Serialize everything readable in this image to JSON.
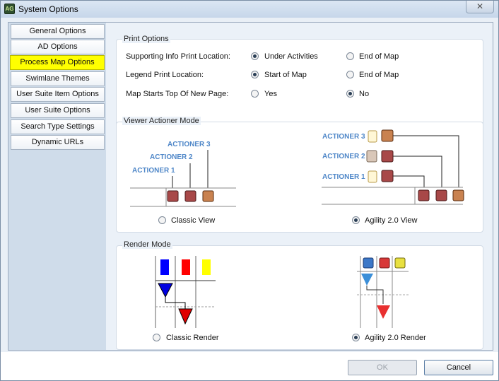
{
  "window": {
    "title": "System Options",
    "close_glyph": "✕",
    "icon_text": "AG"
  },
  "tabs": [
    {
      "label": "General Options"
    },
    {
      "label": "AD Options"
    },
    {
      "label": "Process Map Options"
    },
    {
      "label": "Swimlane Themes"
    },
    {
      "label": "User Suite Item Options"
    },
    {
      "label": "User Suite Options"
    },
    {
      "label": "Search Type Settings"
    },
    {
      "label": "Dynamic URLs"
    }
  ],
  "print_options": {
    "title": "Print Options",
    "rows": [
      {
        "label": "Supporting Info Print Location:",
        "option_a": "Under Activities",
        "option_b": "End of Map",
        "selected": "a"
      },
      {
        "label": "Legend Print Location:",
        "option_a": "Start of Map",
        "option_b": "End of Map",
        "selected": "a"
      },
      {
        "label": "Map Starts Top Of New Page:",
        "option_a": "Yes",
        "option_b": "No",
        "selected": "b"
      }
    ]
  },
  "viewer_actioner_mode": {
    "title": "Viewer Actioner Mode",
    "classic": {
      "label": "Classic View",
      "checked": false,
      "actioners": [
        "ACTIONER 1",
        "ACTIONER 2",
        "ACTIONER 3"
      ]
    },
    "agility": {
      "label": "Agility 2.0 View",
      "checked": true,
      "actioners": [
        "ACTIONER 3",
        "ACTIONER 2",
        "ACTIONER 1"
      ]
    }
  },
  "render_mode": {
    "title": "Render Mode",
    "classic": {
      "label": "Classic Render",
      "checked": false
    },
    "agility": {
      "label": "Agility 2.0 Render",
      "checked": true
    }
  },
  "buttons": {
    "ok": "OK",
    "cancel": "Cancel"
  },
  "colors": {
    "active_tab": "#ffff00",
    "actioner_text": "#4f87c8",
    "box_red": "#a84848",
    "box_orange": "#c98250"
  }
}
